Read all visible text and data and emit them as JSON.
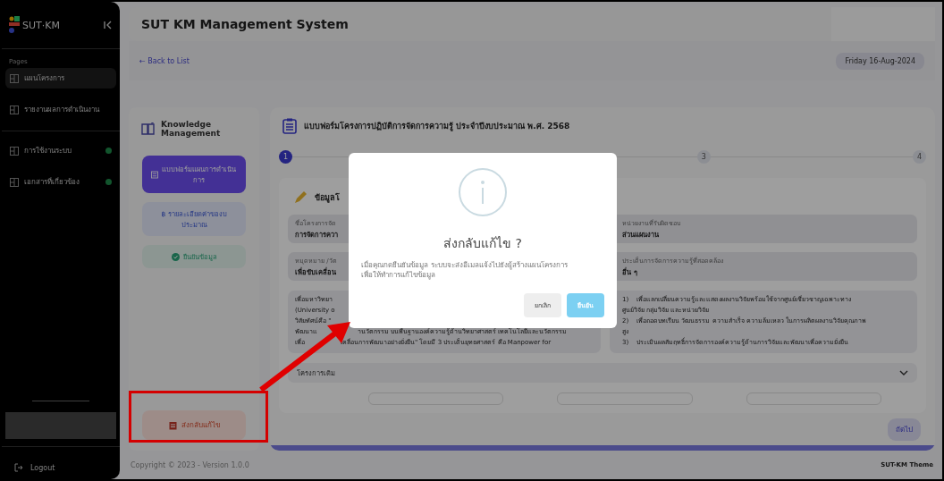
{
  "sidebar": {
    "logo": "SUT·KM",
    "section_label": "Pages",
    "items": [
      {
        "label": "แผนโครงการ",
        "selected": true,
        "dot": false
      },
      {
        "label": "รายงานผลการดำเนินงาน",
        "selected": false,
        "dot": false
      },
      {
        "label": "การใช้งานระบบ",
        "selected": false,
        "dot": true
      },
      {
        "label": "เอกสารที่เกี่ยวข้อง",
        "selected": false,
        "dot": true
      }
    ],
    "logout": "Logout"
  },
  "header": {
    "title": "SUT KM Management System"
  },
  "toolbar": {
    "back": "← Back to List",
    "date": "Friday 16-Aug-2024"
  },
  "steps_panel": {
    "title": "Knowledge Management",
    "steps": [
      {
        "kind": "form",
        "label": "แบบฟอร์มแผนการดำเนินการ",
        "selected": true
      },
      {
        "kind": "budget",
        "label": "฿ รายละเอียดค่าของบประมาณ",
        "selected": false
      },
      {
        "kind": "confirm",
        "label": "ยืนยันข้อมูล",
        "selected": false
      }
    ],
    "return_button": "ส่งกลับแก้ไข"
  },
  "form": {
    "title": "แบบฟอร์มโครงการปฏิบัติการจัดการความรู้ ประจำปีงบประมาณ พ.ศ. 2568",
    "stepper": [
      {
        "label": "1",
        "selected": true
      },
      {
        "label": "3",
        "selected": false
      },
      {
        "label": "4",
        "selected": false
      }
    ],
    "section_title": "ข้อมูลโ",
    "fields": [
      {
        "label": "ชื่อโครงการจัด",
        "value": "การจัดการควา"
      },
      {
        "label": "หน่วยงานที่รับผิดชอบ",
        "value": "ส่วนแผนงาน"
      },
      {
        "label": "หมุดหมาย /วัต",
        "value": "เพื่อขับเคลื่อน"
      },
      {
        "label": "ประเด็นการจัดการความรู้ที่สอดคล้อง",
        "value": "อื่น ๆ"
      }
    ],
    "text_areas": [
      {
        "lines": [
          "เพื่อมหาวิทยา",
          "(University o",
          "วิสัยทัศน์คือ \"",
          "พัฒนาแ                    านวัตกรรม บนพื้นฐานองค์ความรู้ด้านวิทยาศาสตร์ เทคโนโลยีและนวัตกรรม",
          "เพื่อ                  เคลื่อนการพัฒนาอย่างยั่งยืน\" โดยมี 3 ประเด็นยุทธศาสตร์ คือ Manpower for"
        ]
      },
      {
        "lines": [
          "1)    เพื่อแลกเปลี่ยนความรู้และแสดงผลงานวิจัยพร้อมใช้จากศูนย์เชี่ยวชาญเฉพาะทาง",
          "ศูนย์วิจัย กลุ่มวิจัย และหน่วยวิจัย",
          "2)    เพื่อถอดบทเรียน วัฒนธรรม ความสำเร็จ ความล้มเหลว ในการผลิตผลงานวิจัยคุณภาพ",
          "สูง",
          "3)    ประเมินผลสัมฤทธิ์การจัดการองค์ความรู้ด้านการวิจัยและพัฒนาเพื่อความยั่งยืน"
        ]
      }
    ],
    "accordion": {
      "label": "โครงการเดิม",
      "expanded": false
    },
    "next_button": "ถัดไป"
  },
  "dialog": {
    "title": "ส่งกลับแก้ไข ?",
    "message": "เมื่อคุณกดยืนยันข้อมูล ระบบจะส่งอีเมลแจ้งไปยังผู้สร้างแผนโครงการ เพื่อให้ทำการแก้ไขข้อมูล",
    "cancel": "ยกเลิก",
    "confirm": "ยืนยัน"
  },
  "footer": {
    "copyright": "Copyright © 2023 - Version 1.0.0",
    "theme": "SUT-KM Theme"
  }
}
